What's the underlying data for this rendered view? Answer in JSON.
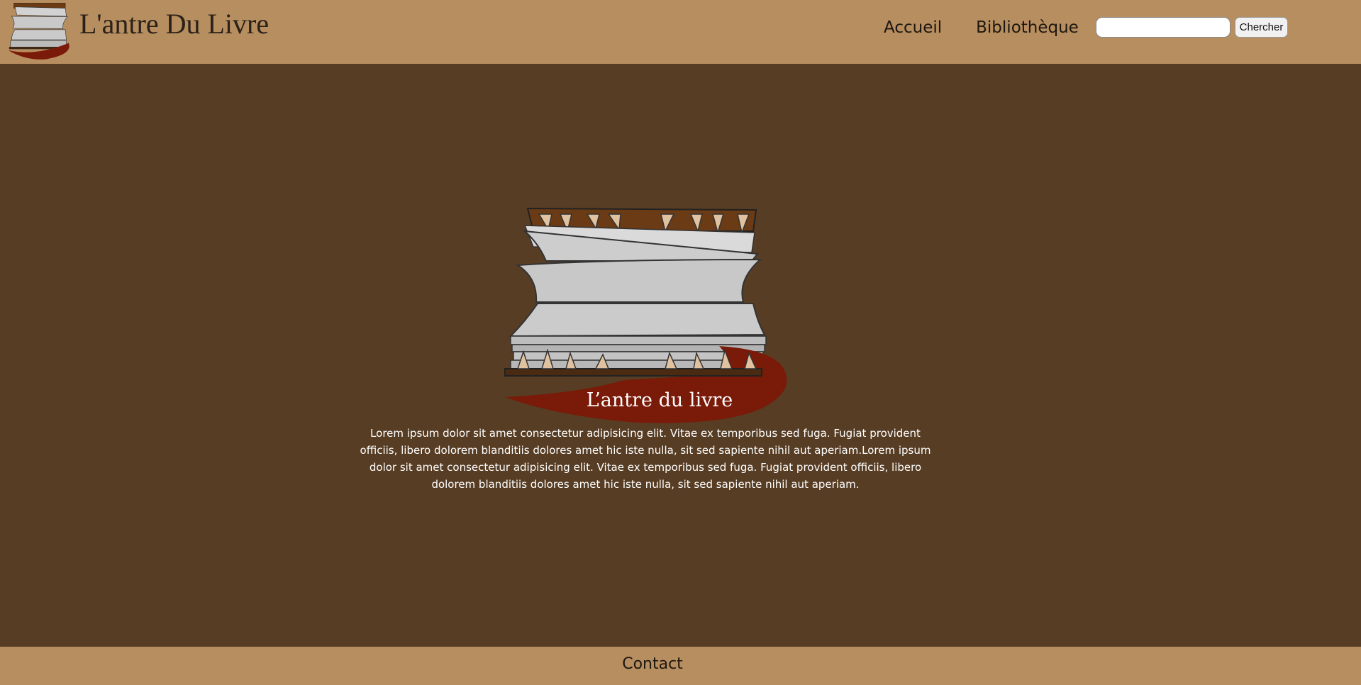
{
  "header": {
    "site_title": "L'antre Du Livre",
    "nav": [
      {
        "label": "Accueil"
      },
      {
        "label": "Bibliothèque"
      }
    ],
    "search": {
      "value": "",
      "placeholder": "",
      "button_label": "Chercher"
    }
  },
  "hero": {
    "logo_icon": "mimic-book-logo",
    "logo_text": "L’antre du livre",
    "intro": "Lorem ipsum dolor sit amet consectetur adipisicing elit. Vitae ex temporibus sed fuga. Fugiat provident officiis, libero dolorem blanditiis dolores amet hic iste nulla, sit sed sapiente nihil aut aperiam.Lorem ipsum dolor sit amet consectetur adipisicing elit. Vitae ex temporibus sed fuga. Fugiat provident officiis, libero dolorem blanditiis dolores amet hic iste nulla, sit sed sapiente nihil aut aperiam."
  },
  "footer": {
    "contact_label": "Contact"
  },
  "colors": {
    "header_bg": "#b78e5f",
    "page_bg": "#573d24",
    "ribbon": "#7a1a08",
    "book_cover": "#6b3b15",
    "pages": "#cfcfcf",
    "teeth": "#e0c2a0"
  }
}
